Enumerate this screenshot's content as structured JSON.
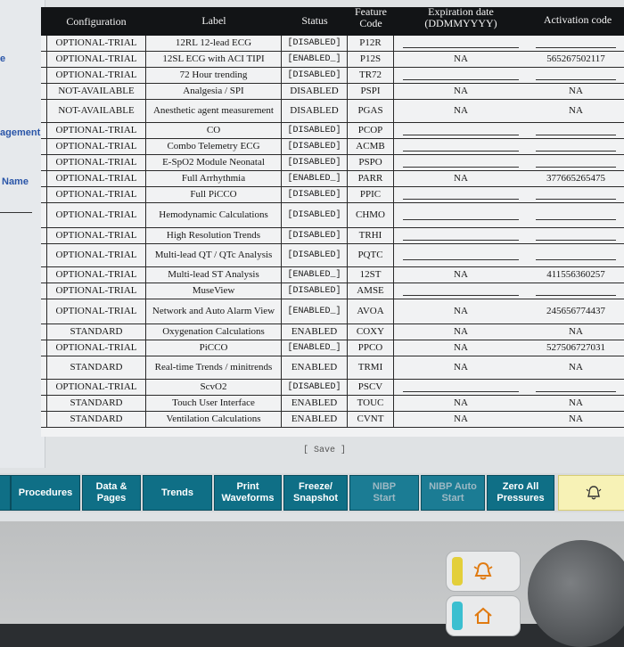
{
  "left_panel": {
    "items": [
      "e",
      "agement",
      "Name"
    ]
  },
  "table": {
    "headers": {
      "configuration": "Configuration",
      "label": "Label",
      "status": "Status",
      "feature": "Feature\nCode",
      "expiration": "Expiration date\n(DDMMYYYY)",
      "activation": "Activation code"
    },
    "rows": [
      {
        "config": "OPTIONAL-TRIAL",
        "label": "12RL 12-lead ECG",
        "status": "[DISABLED]",
        "feature": "P12R",
        "exp": "",
        "act": ""
      },
      {
        "config": "OPTIONAL-TRIAL",
        "label": "12SL ECG with ACI TIPI",
        "status": "[ENABLED_]",
        "feature": "P12S",
        "exp": "NA",
        "act": "565267502117"
      },
      {
        "config": "OPTIONAL-TRIAL",
        "label": "72 Hour trending",
        "status": "[DISABLED]",
        "feature": "TR72",
        "exp": "",
        "act": ""
      },
      {
        "config": "NOT-AVAILABLE",
        "label": "Analgesia / SPI",
        "status": "DISABLED",
        "feature": "PSPI",
        "exp": "NA",
        "act": "NA"
      },
      {
        "config": "NOT-AVAILABLE",
        "label": "Anesthetic agent measurement",
        "status": "DISABLED",
        "feature": "PGAS",
        "exp": "NA",
        "act": "NA"
      },
      {
        "config": "OPTIONAL-TRIAL",
        "label": "CO",
        "status": "[DISABLED]",
        "feature": "PCOP",
        "exp": "",
        "act": ""
      },
      {
        "config": "OPTIONAL-TRIAL",
        "label": "Combo Telemetry ECG",
        "status": "[DISABLED]",
        "feature": "ACMB",
        "exp": "",
        "act": ""
      },
      {
        "config": "OPTIONAL-TRIAL",
        "label": "E-SpO2 Module Neonatal",
        "status": "[DISABLED]",
        "feature": "PSPO",
        "exp": "",
        "act": ""
      },
      {
        "config": "OPTIONAL-TRIAL",
        "label": "Full Arrhythmia",
        "status": "[ENABLED_]",
        "feature": "PARR",
        "exp": "NA",
        "act": "377665265475"
      },
      {
        "config": "OPTIONAL-TRIAL",
        "label": "Full PiCCO",
        "status": "[DISABLED]",
        "feature": "PPIC",
        "exp": "",
        "act": ""
      },
      {
        "config": "OPTIONAL-TRIAL",
        "label": "Hemodynamic Calculations",
        "status": "[DISABLED]",
        "feature": "CHMO",
        "exp": "",
        "act": ""
      },
      {
        "config": "OPTIONAL-TRIAL",
        "label": "High Resolution Trends",
        "status": "[DISABLED]",
        "feature": "TRHI",
        "exp": "",
        "act": ""
      },
      {
        "config": "OPTIONAL-TRIAL",
        "label": "Multi-lead QT / QTc Analysis",
        "status": "[DISABLED]",
        "feature": "PQTC",
        "exp": "",
        "act": ""
      },
      {
        "config": "OPTIONAL-TRIAL",
        "label": "Multi-lead ST Analysis",
        "status": "[ENABLED_]",
        "feature": "12ST",
        "exp": "NA",
        "act": "411556360257"
      },
      {
        "config": "OPTIONAL-TRIAL",
        "label": "MuseView",
        "status": "[DISABLED]",
        "feature": "AMSE",
        "exp": "",
        "act": ""
      },
      {
        "config": "OPTIONAL-TRIAL",
        "label": "Network and Auto Alarm View",
        "status": "[ENABLED_]",
        "feature": "AVOA",
        "exp": "NA",
        "act": "245656774437"
      },
      {
        "config": "STANDARD",
        "label": "Oxygenation Calculations",
        "status": "ENABLED",
        "feature": "COXY",
        "exp": "NA",
        "act": "NA"
      },
      {
        "config": "OPTIONAL-TRIAL",
        "label": "PiCCO",
        "status": "[ENABLED_]",
        "feature": "PPCO",
        "exp": "NA",
        "act": "527506727031"
      },
      {
        "config": "STANDARD",
        "label": "Real-time Trends / minitrends",
        "status": "ENABLED",
        "feature": "TRMI",
        "exp": "NA",
        "act": "NA"
      },
      {
        "config": "OPTIONAL-TRIAL",
        "label": "ScvO2",
        "status": "[DISABLED]",
        "feature": "PSCV",
        "exp": "",
        "act": ""
      },
      {
        "config": "STANDARD",
        "label": "Touch User Interface",
        "status": "ENABLED",
        "feature": "TOUC",
        "exp": "NA",
        "act": "NA"
      },
      {
        "config": "STANDARD",
        "label": "Ventilation Calculations",
        "status": "ENABLED",
        "feature": "CVNT",
        "exp": "NA",
        "act": "NA"
      }
    ]
  },
  "save_label": "[ Save ]",
  "buttons": {
    "procedures": "Procedures",
    "data_pages": "Data &\nPages",
    "trends": "Trends",
    "print_waveforms": "Print\nWaveforms",
    "freeze_snapshot": "Freeze/\nSnapshot",
    "nibp_start": "NIBP\nStart",
    "nibp_auto_start": "NIBP Auto\nStart",
    "zero_all": "Zero All\nPressures"
  },
  "icons": {
    "alarm": "alarm-bell-icon",
    "home": "home-icon"
  },
  "colors": {
    "button": "#0f6f86",
    "alarm_button": "#f7f2b6",
    "link_text": "#2a55a8"
  }
}
